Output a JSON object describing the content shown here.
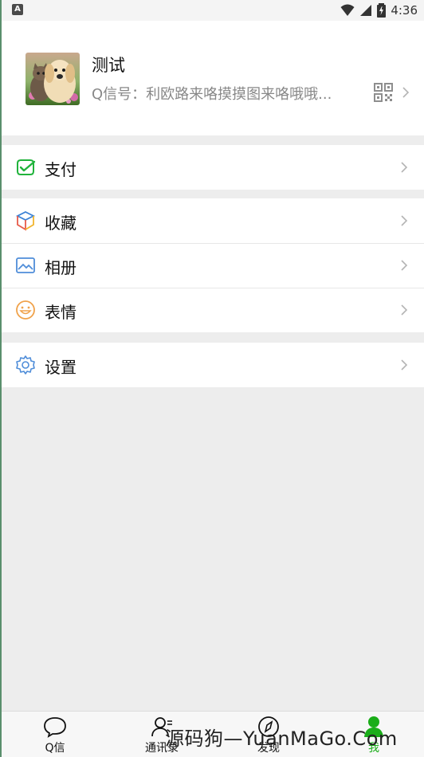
{
  "status": {
    "left_badge": "A",
    "time": "4:36"
  },
  "profile": {
    "name": "测试",
    "id_text": "Q信号：利欧路来咯摸摸图来咯哦哦..."
  },
  "menu": {
    "payment": "支付",
    "favorites": "收藏",
    "album": "相册",
    "stickers": "表情",
    "settings": "设置"
  },
  "tabs": [
    {
      "label": "Q信",
      "icon": "chat-bubble-icon"
    },
    {
      "label": "通讯录",
      "icon": "contacts-icon"
    },
    {
      "label": "发现",
      "icon": "compass-icon"
    },
    {
      "label": "我",
      "icon": "person-icon"
    }
  ],
  "watermark": "源码狗—YuanMaGo.Com",
  "colors": {
    "accent": "#1aad19",
    "background": "#ededed",
    "card": "#ffffff",
    "settings_blue": "#4f8dd9",
    "album_blue": "#4f8dd9",
    "stickers_orange": "#f0a24b"
  }
}
